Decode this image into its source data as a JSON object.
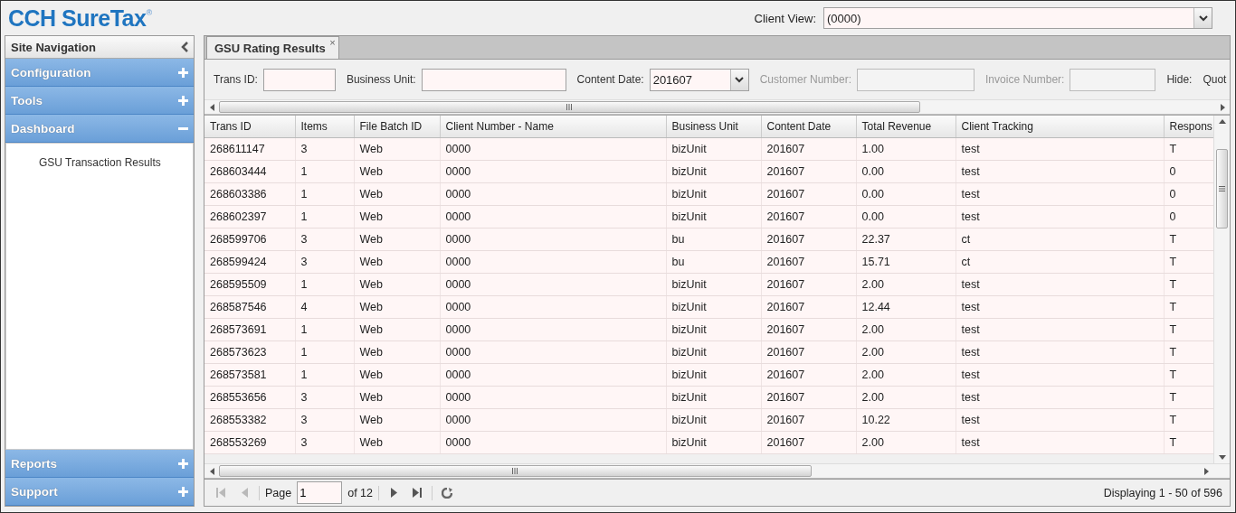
{
  "logo": {
    "text": "CCH SureTax",
    "mark": "®"
  },
  "client_view": {
    "label": "Client View:",
    "value": "(0000)"
  },
  "sidebar": {
    "title": "Site Navigation",
    "sections": [
      {
        "label": "Configuration",
        "expanded": false
      },
      {
        "label": "Tools",
        "expanded": false
      },
      {
        "label": "Dashboard",
        "expanded": true,
        "children": [
          {
            "label": "GSU Transaction Results"
          }
        ]
      }
    ],
    "footer_sections": [
      {
        "label": "Reports",
        "expanded": false
      },
      {
        "label": "Support",
        "expanded": false
      }
    ]
  },
  "tabs": [
    {
      "label": "GSU Rating Results",
      "selected": true,
      "close": "×"
    }
  ],
  "filters": [
    {
      "label": "Trans ID:",
      "kind": "text",
      "disabled": false
    },
    {
      "label": "Business Unit:",
      "kind": "text",
      "disabled": false
    },
    {
      "label": "Content Date:",
      "kind": "combo",
      "value": "201607"
    },
    {
      "label": "Customer Number:",
      "kind": "text",
      "disabled": true
    },
    {
      "label": "Invoice Number:",
      "kind": "text",
      "disabled": true
    },
    {
      "label": "Hide:",
      "kind": "label"
    },
    {
      "label": "Quot",
      "kind": "label"
    }
  ],
  "table": {
    "columns": [
      "Trans ID",
      "Items",
      "File Batch ID",
      "Client Number - Name",
      "Business Unit",
      "Content Date",
      "Total Revenue",
      "Client Tracking",
      "Respons"
    ],
    "rows": [
      [
        "268611147",
        "3",
        "Web",
        "0000",
        "bizUnit",
        "201607",
        "1.00",
        "test",
        "T"
      ],
      [
        "268603444",
        "1",
        "Web",
        "0000",
        "bizUnit",
        "201607",
        "0.00",
        "test",
        "0"
      ],
      [
        "268603386",
        "1",
        "Web",
        "0000",
        "bizUnit",
        "201607",
        "0.00",
        "test",
        "0"
      ],
      [
        "268602397",
        "1",
        "Web",
        "0000",
        "bizUnit",
        "201607",
        "0.00",
        "test",
        "0"
      ],
      [
        "268599706",
        "3",
        "Web",
        "0000",
        "bu",
        "201607",
        "22.37",
        "ct",
        "T"
      ],
      [
        "268599424",
        "3",
        "Web",
        "0000",
        "bu",
        "201607",
        "15.71",
        "ct",
        "T"
      ],
      [
        "268595509",
        "1",
        "Web",
        "0000",
        "bizUnit",
        "201607",
        "2.00",
        "test",
        "T"
      ],
      [
        "268587546",
        "4",
        "Web",
        "0000",
        "bizUnit",
        "201607",
        "12.44",
        "test",
        "T"
      ],
      [
        "268573691",
        "1",
        "Web",
        "0000",
        "bizUnit",
        "201607",
        "2.00",
        "test",
        "T"
      ],
      [
        "268573623",
        "1",
        "Web",
        "0000",
        "bizUnit",
        "201607",
        "2.00",
        "test",
        "T"
      ],
      [
        "268573581",
        "1",
        "Web",
        "0000",
        "bizUnit",
        "201607",
        "2.00",
        "test",
        "T"
      ],
      [
        "268553656",
        "3",
        "Web",
        "0000",
        "bizUnit",
        "201607",
        "2.00",
        "test",
        "T"
      ],
      [
        "268553382",
        "3",
        "Web",
        "0000",
        "bizUnit",
        "201607",
        "10.22",
        "test",
        "T"
      ],
      [
        "268553269",
        "3",
        "Web",
        "0000",
        "bizUnit",
        "201607",
        "2.00",
        "test",
        "T"
      ]
    ]
  },
  "pager": {
    "page_label": "Page",
    "page": "1",
    "of": "of 12",
    "first_disabled": true,
    "prev_disabled": true,
    "next_disabled": false,
    "last_disabled": false,
    "summary": "Displaying 1 - 50 of 596"
  }
}
